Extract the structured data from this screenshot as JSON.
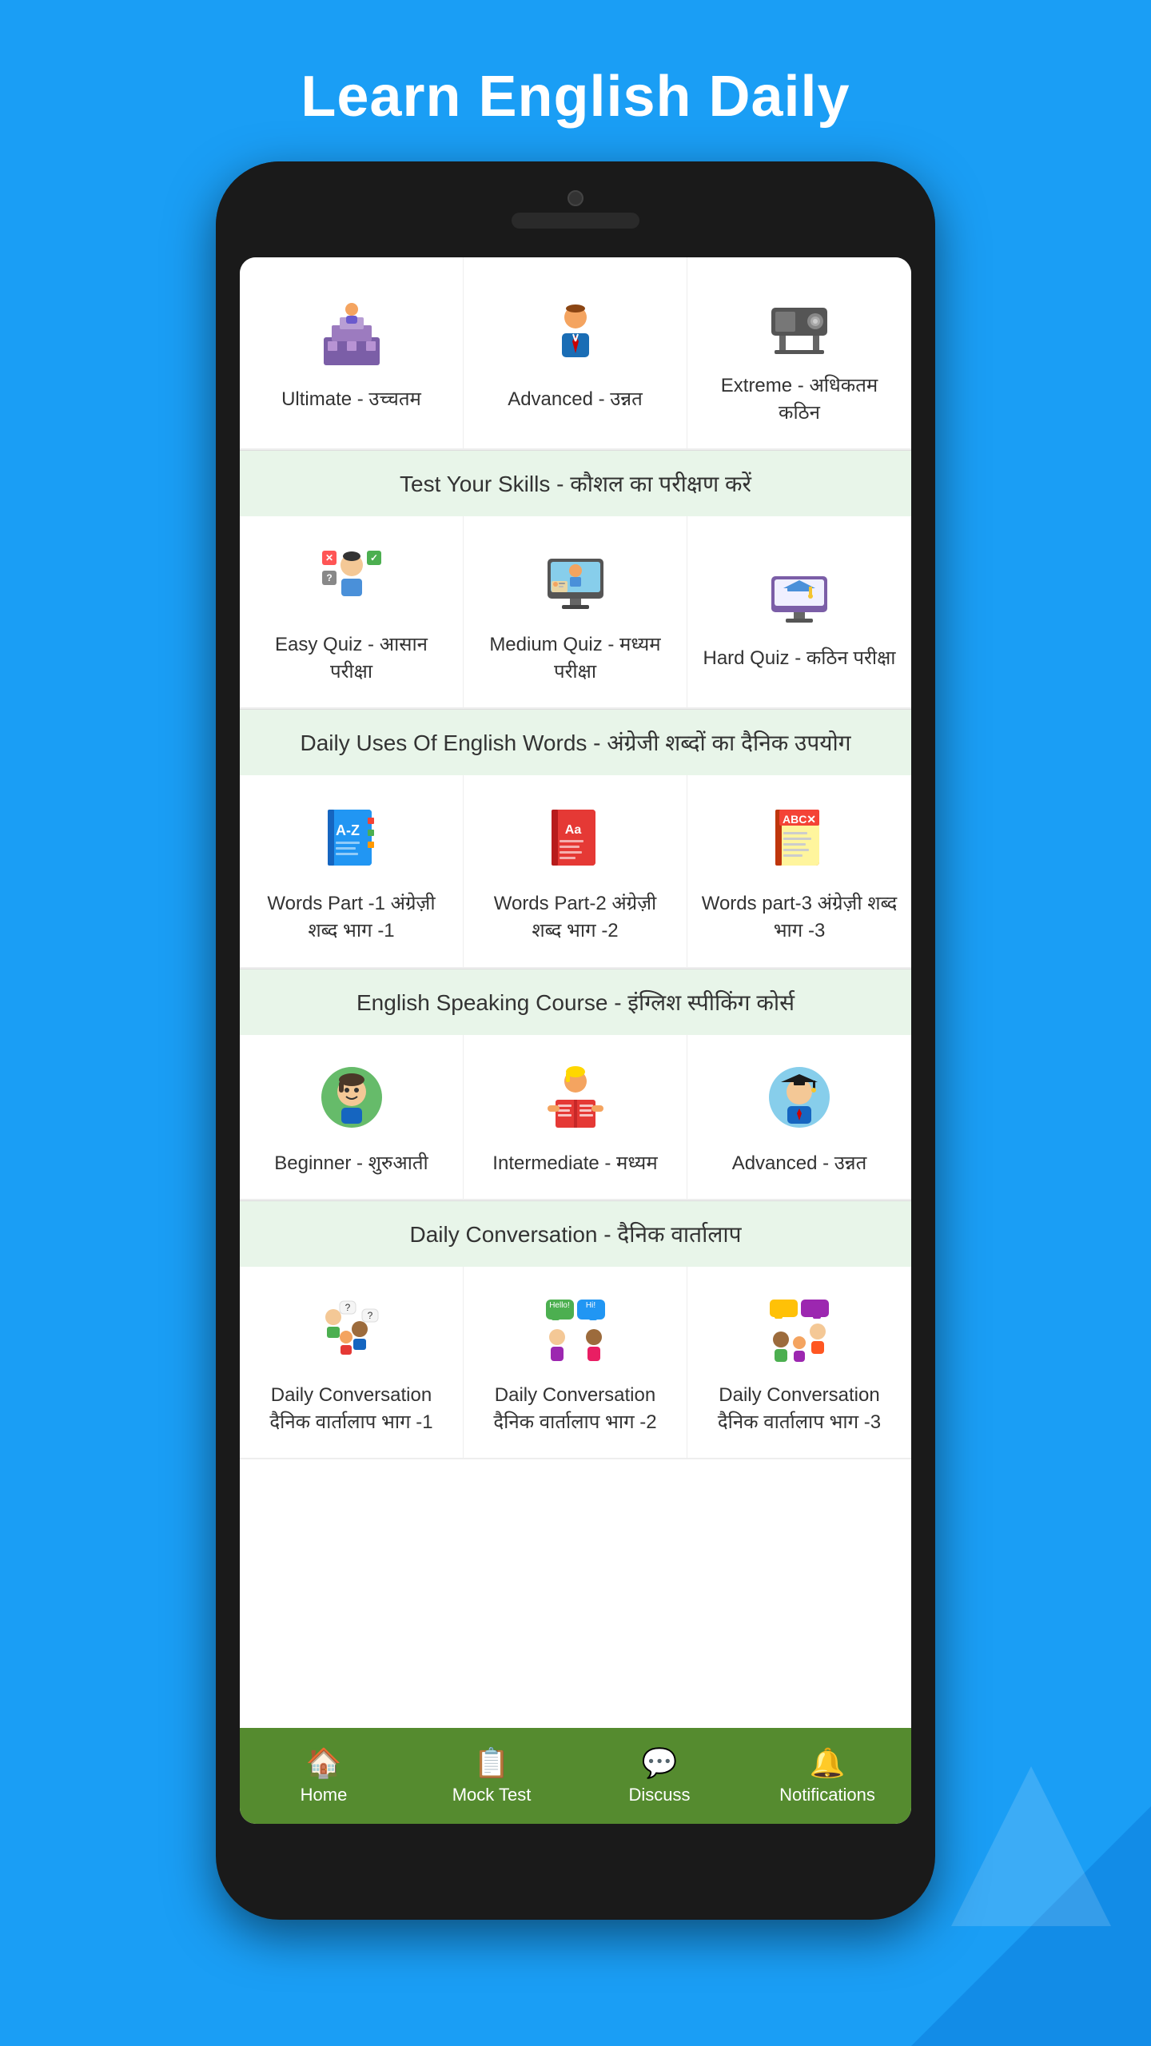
{
  "app": {
    "title": "Learn English Daily"
  },
  "sections": [
    {
      "id": "levels",
      "header": null,
      "items": [
        {
          "label": "Ultimate - उच्चतम",
          "icon": "ultimate"
        },
        {
          "label": "Advanced - उन्नत",
          "icon": "advanced-level"
        },
        {
          "label": "Extreme - अधिकतम कठिन",
          "icon": "extreme"
        }
      ]
    },
    {
      "id": "quiz",
      "header": "Test Your Skills - कौशल का परीक्षण करें",
      "items": [
        {
          "label": "Easy Quiz - आसान परीक्षा",
          "icon": "easy-quiz"
        },
        {
          "label": "Medium Quiz - मध्यम परीक्षा",
          "icon": "medium-quiz"
        },
        {
          "label": "Hard Quiz - कठिन परीक्षा",
          "icon": "hard-quiz"
        }
      ]
    },
    {
      "id": "words",
      "header": "Daily Uses Of English Words - अंग्रेजी शब्दों का दैनिक उपयोग",
      "items": [
        {
          "label": "Words Part -1 अंग्रेज़ी शब्द भाग -1",
          "icon": "words-1"
        },
        {
          "label": "Words Part-2 अंग्रेज़ी शब्द भाग -2",
          "icon": "words-2"
        },
        {
          "label": "Words part-3 अंग्रेज़ी शब्द भाग -3",
          "icon": "words-3"
        }
      ]
    },
    {
      "id": "speaking",
      "header": "English Speaking Course - इंग्लिश स्पीकिंग कोर्स",
      "items": [
        {
          "label": "Beginner - शुरुआती",
          "icon": "beginner"
        },
        {
          "label": "Intermediate - मध्यम",
          "icon": "intermediate"
        },
        {
          "label": "Advanced - उन्नत",
          "icon": "advanced-speaking"
        }
      ]
    },
    {
      "id": "conversation",
      "header": "Daily Conversation - दैनिक वार्तालाप",
      "items": [
        {
          "label": "Daily Conversation दैनिक वार्तालाप भाग -1",
          "icon": "conversation-1"
        },
        {
          "label": "Daily Conversation दैनिक वार्तालाप भाग -2",
          "icon": "conversation-2"
        },
        {
          "label": "Daily Conversation दैनिक वार्तालाप भाग -3",
          "icon": "conversation-3"
        }
      ]
    }
  ],
  "bottomNav": {
    "items": [
      {
        "id": "home",
        "label": "Home",
        "icon": "🏠",
        "active": true
      },
      {
        "id": "mock-test",
        "label": "Mock Test",
        "icon": "📋",
        "active": false
      },
      {
        "id": "discuss",
        "label": "Discuss",
        "icon": "💬",
        "active": false
      },
      {
        "id": "notifications",
        "label": "Notifications",
        "icon": "🔔",
        "active": false
      }
    ]
  }
}
